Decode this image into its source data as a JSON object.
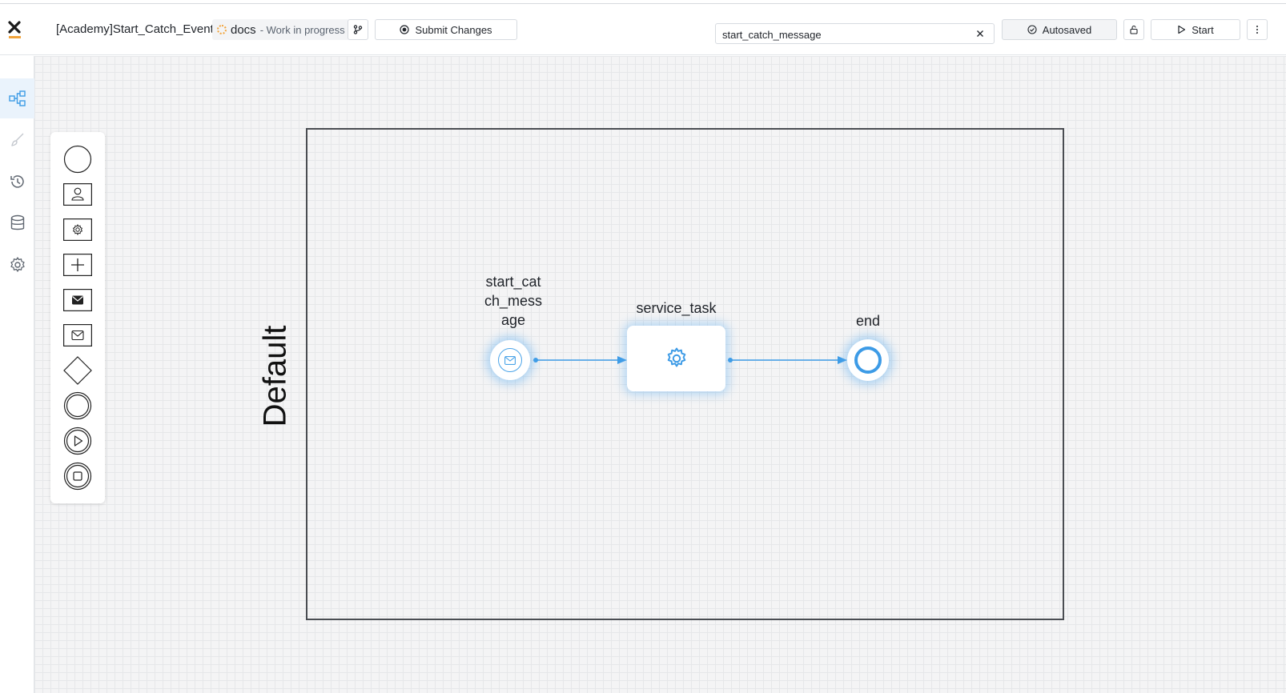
{
  "app": {
    "logo_icon": "x-logo-icon",
    "accent_color": "#3d9be6",
    "brand_underline_color": "#f2a33a"
  },
  "header": {
    "process_title": "[Academy]Start_Catch_Event",
    "branch": {
      "name": "docs",
      "status": "- Work in progress",
      "status_icon": "dotted-circle-icon"
    },
    "branch_button_icon": "git-branch-icon",
    "submit_label": "Submit Changes",
    "search": {
      "value": "start_catch_message",
      "clear_icon": "close-icon"
    },
    "autosaved_label": "Autosaved",
    "lock_icon": "lock-icon",
    "start_label": "Start",
    "more_icon": "more-vertical-icon"
  },
  "sidebar": {
    "items": [
      {
        "name": "process-diagram",
        "icon": "flow-diagram-icon",
        "active": true
      },
      {
        "name": "style",
        "icon": "brush-icon",
        "active": false
      },
      {
        "name": "history",
        "icon": "history-icon",
        "active": false
      },
      {
        "name": "data-model",
        "icon": "database-icon",
        "active": false
      },
      {
        "name": "settings",
        "icon": "gear-icon",
        "active": false
      }
    ]
  },
  "palette": {
    "items": [
      "start-event-icon",
      "user-task-icon",
      "service-task-icon",
      "subprocess-icon",
      "send-message-icon",
      "receive-message-icon",
      "gateway-icon",
      "intermediate-event-icon",
      "start-trigger-icon",
      "end-stop-icon"
    ]
  },
  "diagram": {
    "pool_label": "Default",
    "nodes": {
      "start": {
        "label_lines": [
          "start_cat",
          "ch_mess",
          "age"
        ],
        "icon": "envelope-icon"
      },
      "task": {
        "label": "service_task",
        "icon": "gear-icon"
      },
      "end": {
        "label": "end"
      }
    }
  }
}
